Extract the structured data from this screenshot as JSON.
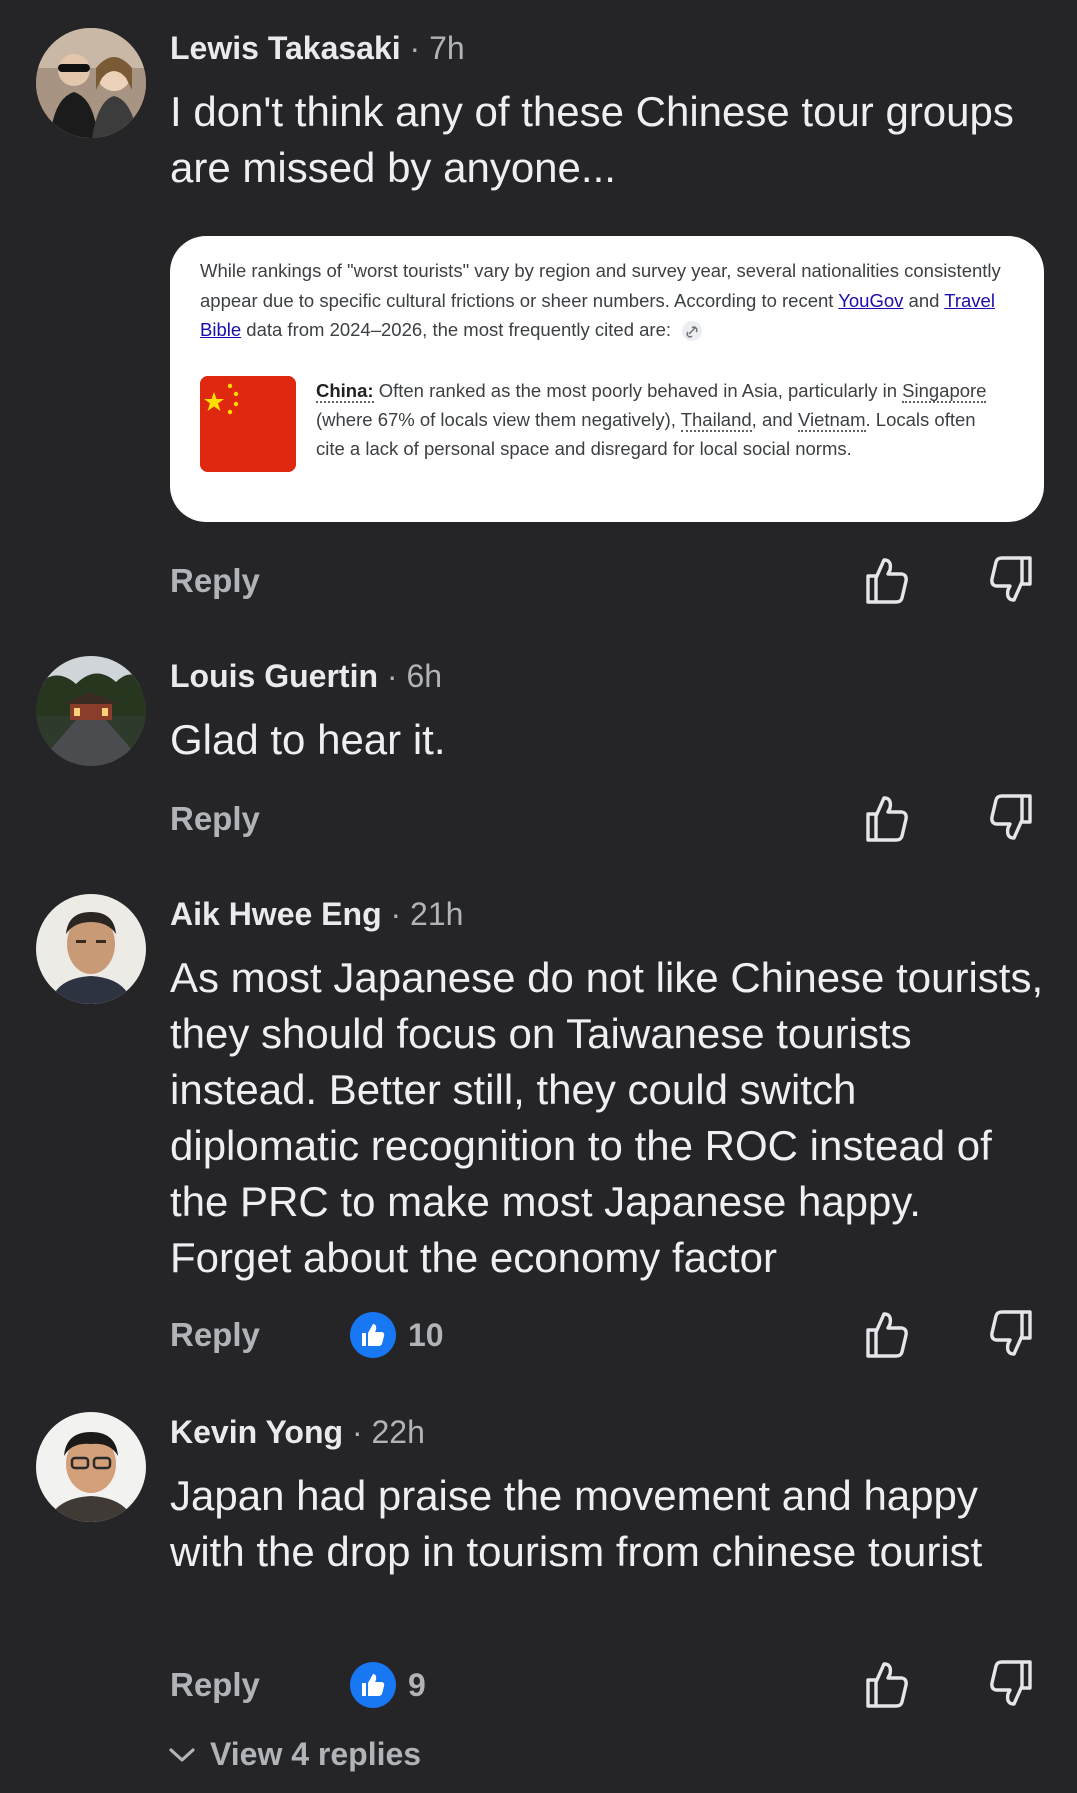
{
  "comments": [
    {
      "name": "Lewis Takasaki",
      "time": "· 7h",
      "text": "I don't think any of these Chinese tour groups are missed by anyone...",
      "reply": "Reply"
    },
    {
      "name": "Louis Guertin",
      "time": "· 6h",
      "text": "Glad to hear it.",
      "reply": "Reply"
    },
    {
      "name": "Aik Hwee Eng",
      "time": "· 21h",
      "text": "As most Japanese do not like Chinese tourists, they should focus on Taiwanese tourists instead. Better still, they could switch diplomatic recognition to the ROC instead of the PRC to make most Japanese happy. Forget about the economy factor",
      "reply": "Reply",
      "likes": "10"
    },
    {
      "name": "Kevin Yong",
      "time": "· 22h",
      "text": "Japan had praise the movement and happy with the drop in tourism from chinese tourist",
      "reply": "Reply",
      "likes": "9"
    }
  ],
  "card": {
    "intro_1": "While rankings of \"worst tourists\" vary by region and survey year, several nationalities consistently appear due to specific cultural frictions or sheer numbers. According to recent ",
    "link_yougov": "YouGov",
    "intro_and": " and ",
    "link_travel_bible": "Travel Bible",
    "intro_2": " data from 2024–2026, the most frequently cited are:",
    "country": "China:",
    "desc_1": " Often ranked as the most poorly behaved in Asia, particularly in ",
    "singapore": "Singapore",
    "desc_2": " (where 67% of locals view them negatively), ",
    "thailand": "Thailand",
    "desc_3": ", and ",
    "vietnam": "Vietnam",
    "desc_4": ". Locals often cite a lack of personal space and disregard for local social norms."
  },
  "view_replies": "View 4 replies",
  "icons": {
    "like": "thumbs-up-outline-icon",
    "dislike": "thumbs-down-outline-icon",
    "like_badge": "thumbs-up-filled-icon",
    "chevron": "chevron-down-icon",
    "link": "link-icon"
  },
  "colors": {
    "background": "#252528",
    "like_blue": "#1877f2",
    "secondary_text": "#b0b3b8"
  }
}
